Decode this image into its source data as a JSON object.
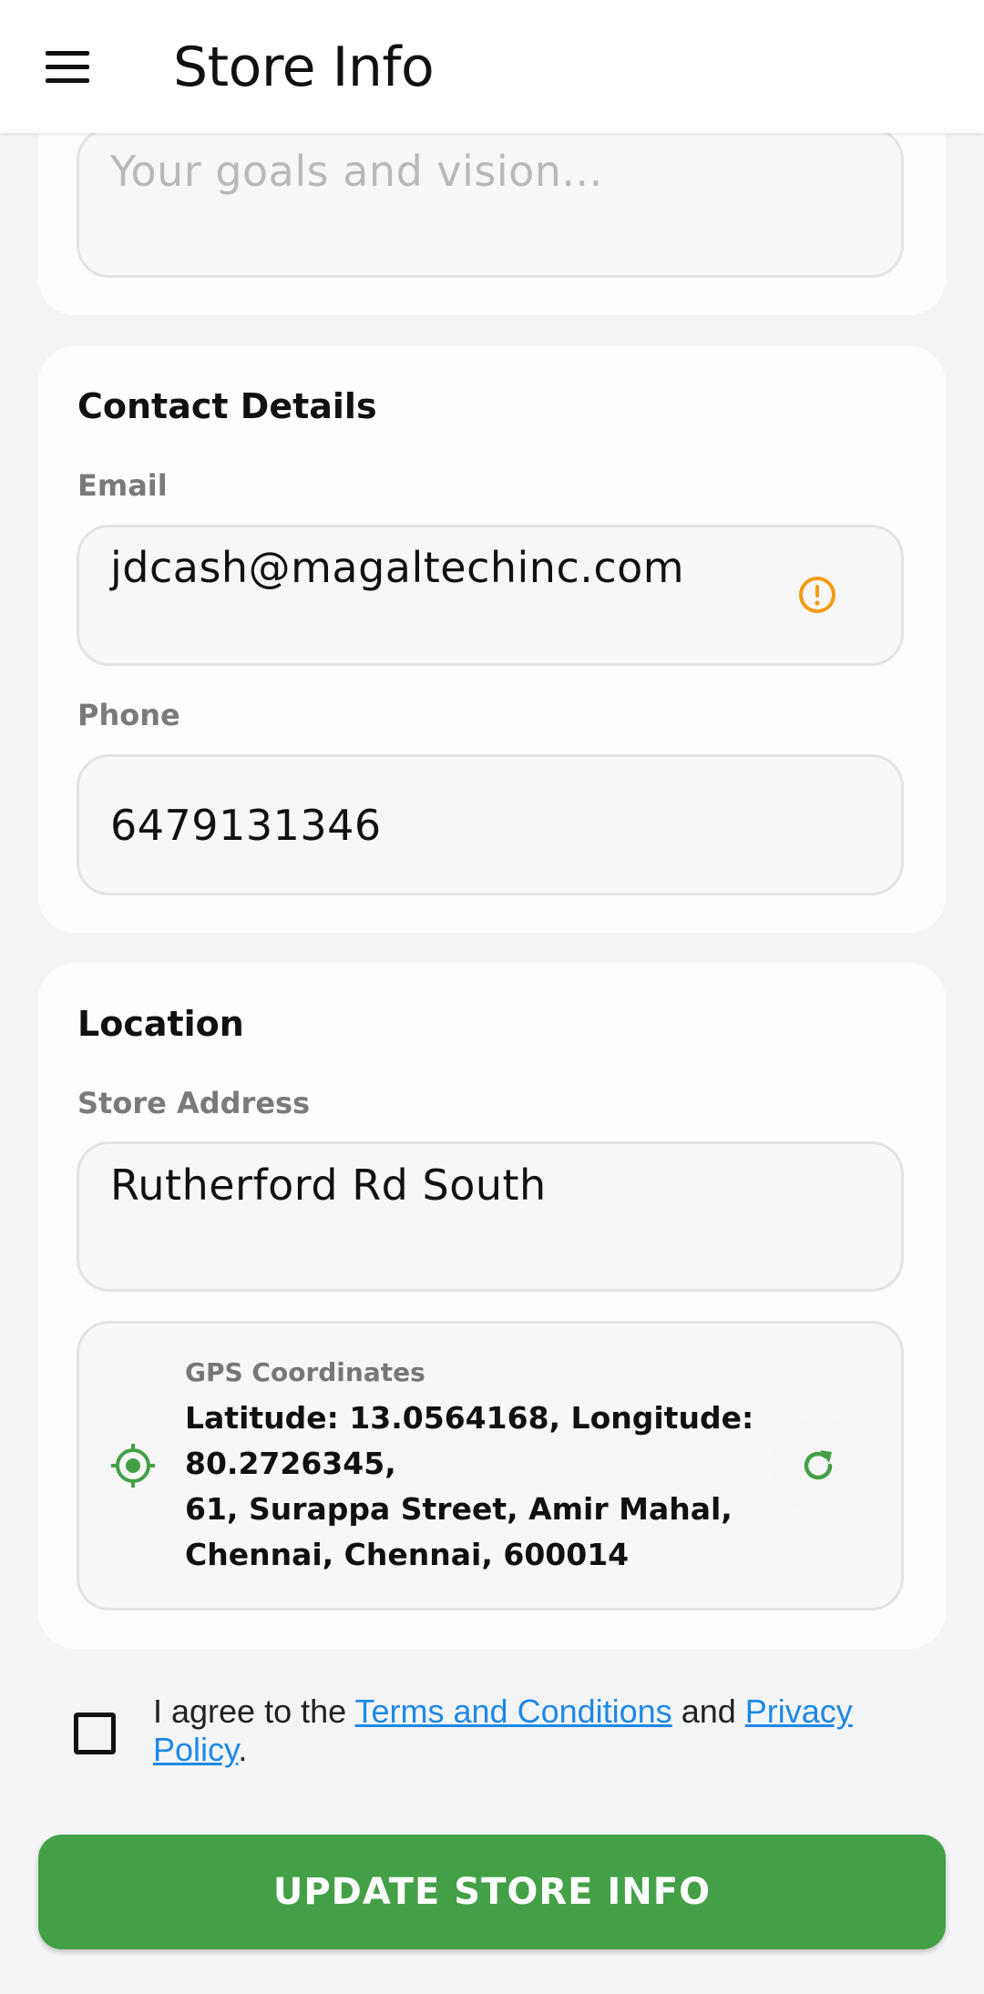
{
  "app_bar": {
    "title": "Store Info",
    "menu_icon": "hamburger-menu-icon"
  },
  "goals": {
    "placeholder": "Your goals and vision..."
  },
  "contact": {
    "title": "Contact Details",
    "email_label": "Email",
    "email_value": "jdcash@magaltechinc.com",
    "email_status_icon": "warning-icon",
    "phone_label": "Phone",
    "phone_value": "6479131346"
  },
  "location": {
    "title": "Location",
    "address_label": "Store Address",
    "address_value": "Rutherford Rd South",
    "gps": {
      "label": "GPS Coordinates",
      "line1": "Latitude: 13.0564168, Longitude:",
      "line2": "80.2726345,",
      "line3": "61, Surappa Street, Amir Mahal,",
      "line4": "Chennai, Chennai, 600014",
      "locate_icon": "gps-target-icon",
      "refresh_icon": "refresh-icon"
    }
  },
  "agreement": {
    "prefix": "I agree to the ",
    "terms_link": "Terms and Conditions",
    "middle": " and ",
    "privacy_link": "Privacy Policy",
    "suffix": "."
  },
  "submit_label": "UPDATE STORE INFO",
  "colors": {
    "primary_green": "#43a047",
    "link_blue": "#1e88e5",
    "warning_orange": "#f39c12",
    "background": "#f3f4f6"
  }
}
